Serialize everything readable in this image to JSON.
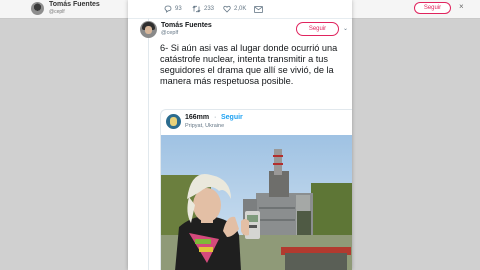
{
  "background": {
    "profile_name": "Tomás Fuentes",
    "profile_handle": "@ceplf",
    "follow_label": "Seguir",
    "close_icon": "×"
  },
  "actions": {
    "replies": "93",
    "retweets": "233",
    "likes": "2,0K"
  },
  "tweet": {
    "author_name": "Tomás Fuentes",
    "author_handle": "@ceplf",
    "follow_label": "Seguir",
    "text": "6- Si aún asi vas al lugar donde ocurrió una catástrofe nuclear, intenta transmitir a tus seguidores el drama que allí se vivió, de la manera más respetuosa posible."
  },
  "quoted": {
    "author_name": "166mm",
    "separator": "·",
    "follow_label": "Seguir",
    "location": "Pripyat, Ukraine"
  },
  "colors": {
    "accent_red": "#e0245e",
    "link_blue": "#1da1f2",
    "muted": "#657786",
    "text": "#14171a"
  },
  "icons": [
    "reply-icon",
    "retweet-icon",
    "like-icon",
    "message-icon",
    "chevron-down-icon"
  ]
}
